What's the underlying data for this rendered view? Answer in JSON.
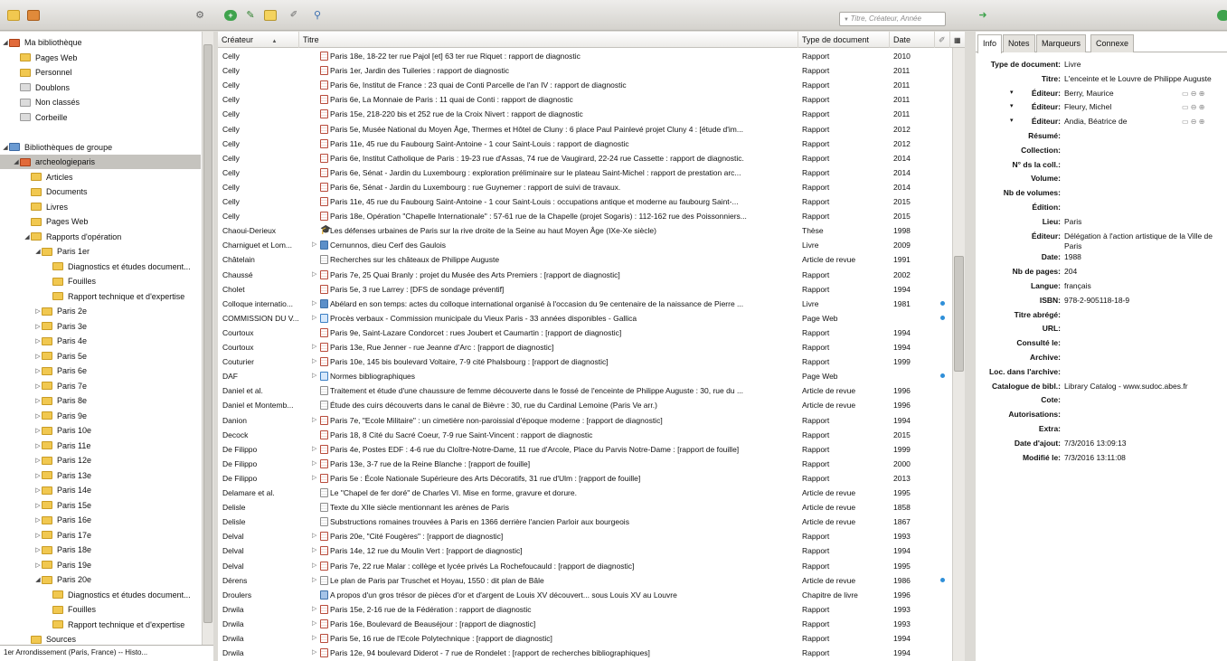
{
  "toolbar": {
    "search_placeholder": "Titre, Créateur, Année"
  },
  "left_tree": [
    {
      "label": "Ma bibliothèque",
      "indent": 0,
      "twisty": "◢",
      "folder": "red"
    },
    {
      "label": "Pages Web",
      "indent": 1,
      "twisty": "",
      "folder": "yel"
    },
    {
      "label": "Personnel",
      "indent": 1,
      "twisty": "",
      "folder": "yel"
    },
    {
      "label": "Doublons",
      "indent": 1,
      "twisty": "",
      "folder": "grey"
    },
    {
      "label": "Non classés",
      "indent": 1,
      "twisty": "",
      "folder": "grey"
    },
    {
      "label": "Corbeille",
      "indent": 1,
      "twisty": "",
      "folder": "grey"
    },
    {
      "label": "",
      "indent": 0,
      "twisty": "",
      "folder": ""
    },
    {
      "label": "Bibliothèques de groupe",
      "indent": 0,
      "twisty": "◢",
      "folder": "grp"
    },
    {
      "label": "archeologieparis",
      "indent": 1,
      "twisty": "◢",
      "folder": "red",
      "selected": true
    },
    {
      "label": "Articles",
      "indent": 2,
      "twisty": "",
      "folder": "yel"
    },
    {
      "label": "Documents",
      "indent": 2,
      "twisty": "",
      "folder": "yel"
    },
    {
      "label": "Livres",
      "indent": 2,
      "twisty": "",
      "folder": "yel"
    },
    {
      "label": "Pages Web",
      "indent": 2,
      "twisty": "",
      "folder": "yel"
    },
    {
      "label": "Rapports d'opération",
      "indent": 2,
      "twisty": "◢",
      "folder": "yel"
    },
    {
      "label": "Paris 1er",
      "indent": 3,
      "twisty": "◢",
      "folder": "yel"
    },
    {
      "label": "Diagnostics et études document...",
      "indent": 4,
      "twisty": "",
      "folder": "yel"
    },
    {
      "label": "Fouilles",
      "indent": 4,
      "twisty": "",
      "folder": "yel"
    },
    {
      "label": "Rapport technique et d'expertise",
      "indent": 4,
      "twisty": "",
      "folder": "yel"
    },
    {
      "label": "Paris 2e",
      "indent": 3,
      "twisty": "▷",
      "folder": "yel"
    },
    {
      "label": "Paris 3e",
      "indent": 3,
      "twisty": "▷",
      "folder": "yel"
    },
    {
      "label": "Paris 4e",
      "indent": 3,
      "twisty": "▷",
      "folder": "yel"
    },
    {
      "label": "Paris 5e",
      "indent": 3,
      "twisty": "▷",
      "folder": "yel"
    },
    {
      "label": "Paris 6e",
      "indent": 3,
      "twisty": "▷",
      "folder": "yel"
    },
    {
      "label": "Paris 7e",
      "indent": 3,
      "twisty": "▷",
      "folder": "yel"
    },
    {
      "label": "Paris 8e",
      "indent": 3,
      "twisty": "▷",
      "folder": "yel"
    },
    {
      "label": "Paris 9e",
      "indent": 3,
      "twisty": "▷",
      "folder": "yel"
    },
    {
      "label": "Paris 10e",
      "indent": 3,
      "twisty": "▷",
      "folder": "yel"
    },
    {
      "label": "Paris 11e",
      "indent": 3,
      "twisty": "▷",
      "folder": "yel"
    },
    {
      "label": "Paris 12e",
      "indent": 3,
      "twisty": "▷",
      "folder": "yel"
    },
    {
      "label": "Paris 13e",
      "indent": 3,
      "twisty": "▷",
      "folder": "yel"
    },
    {
      "label": "Paris 14e",
      "indent": 3,
      "twisty": "▷",
      "folder": "yel"
    },
    {
      "label": "Paris 15e",
      "indent": 3,
      "twisty": "▷",
      "folder": "yel"
    },
    {
      "label": "Paris 16e",
      "indent": 3,
      "twisty": "▷",
      "folder": "yel"
    },
    {
      "label": "Paris 17e",
      "indent": 3,
      "twisty": "▷",
      "folder": "yel"
    },
    {
      "label": "Paris 18e",
      "indent": 3,
      "twisty": "▷",
      "folder": "yel"
    },
    {
      "label": "Paris 19e",
      "indent": 3,
      "twisty": "▷",
      "folder": "yel"
    },
    {
      "label": "Paris 20e",
      "indent": 3,
      "twisty": "◢",
      "folder": "yel"
    },
    {
      "label": "Diagnostics et études document...",
      "indent": 4,
      "twisty": "",
      "folder": "yel"
    },
    {
      "label": "Fouilles",
      "indent": 4,
      "twisty": "",
      "folder": "yel"
    },
    {
      "label": "Rapport technique et d'expertise",
      "indent": 4,
      "twisty": "",
      "folder": "yel"
    },
    {
      "label": "Sources",
      "indent": 2,
      "twisty": "",
      "folder": "yel"
    }
  ],
  "left_status": "1er Arrondissement (Paris, France) -- Histo...",
  "columns": {
    "creator": "Créateur",
    "title": "Titre",
    "type": "Type de document",
    "date": "Date"
  },
  "items": [
    {
      "creator": "Celly",
      "title": "Paris 18e, 18-22 ter rue Pajol [et] 63 ter rue Riquet : rapport de diagnostic",
      "type": "Rapport",
      "date": "2010",
      "icon": "rapport",
      "twisty": "",
      "attach": false
    },
    {
      "creator": "Celly",
      "title": "Paris 1er, Jardin des Tuileries : rapport de diagnostic",
      "type": "Rapport",
      "date": "2011",
      "icon": "rapport",
      "twisty": "",
      "attach": false
    },
    {
      "creator": "Celly",
      "title": "Paris 6e, Institut de France : 23 quai de Conti Parcelle de l'an IV : rapport de diagnostic",
      "type": "Rapport",
      "date": "2011",
      "icon": "rapport",
      "twisty": "",
      "attach": false
    },
    {
      "creator": "Celly",
      "title": "Paris 6e, La Monnaie de Paris : 11 quai de Conti : rapport de diagnostic",
      "type": "Rapport",
      "date": "2011",
      "icon": "rapport",
      "twisty": "",
      "attach": false
    },
    {
      "creator": "Celly",
      "title": "Paris 15e, 218-220 bis et 252 rue de la Croix Nivert : rapport de diagnostic",
      "type": "Rapport",
      "date": "2011",
      "icon": "rapport",
      "twisty": "",
      "attach": false
    },
    {
      "creator": "Celly",
      "title": "Paris 5e, Musée National du Moyen Âge, Thermes et Hôtel de Cluny : 6 place Paul Painlevé projet Cluny 4 : [étude d'im...",
      "type": "Rapport",
      "date": "2012",
      "icon": "rapport",
      "twisty": "",
      "attach": false
    },
    {
      "creator": "Celly",
      "title": "Paris 11e, 45 rue du Faubourg Saint-Antoine - 1 cour Saint-Louis : rapport de diagnostic",
      "type": "Rapport",
      "date": "2012",
      "icon": "rapport",
      "twisty": "",
      "attach": false
    },
    {
      "creator": "Celly",
      "title": "Paris 6e, Institut Catholique de Paris : 19-23 rue d'Assas, 74 rue de Vaugirard, 22-24 rue Cassette : rapport de diagnostic.",
      "type": "Rapport",
      "date": "2014",
      "icon": "rapport",
      "twisty": "",
      "attach": false
    },
    {
      "creator": "Celly",
      "title": "Paris 6e, Sénat - Jardin du Luxembourg : exploration préliminaire sur le plateau Saint-Michel : rapport de prestation arc...",
      "type": "Rapport",
      "date": "2014",
      "icon": "rapport",
      "twisty": "",
      "attach": false
    },
    {
      "creator": "Celly",
      "title": "Paris 6e, Sénat - Jardin du Luxembourg : rue Guynemer : rapport de suivi de travaux.",
      "type": "Rapport",
      "date": "2014",
      "icon": "rapport",
      "twisty": "",
      "attach": false
    },
    {
      "creator": "Celly",
      "title": "Paris 11e, 45 rue du Faubourg Saint-Antoine - 1 cour Saint-Louis : occupations antique et moderne au faubourg Saint-...",
      "type": "Rapport",
      "date": "2015",
      "icon": "rapport",
      "twisty": "",
      "attach": false
    },
    {
      "creator": "Celly",
      "title": "Paris 18e, Opération \"Chapelle Internationale\" : 57-61 rue de la Chapelle (projet Sogaris) : 112-162 rue des Poissonniers...",
      "type": "Rapport",
      "date": "2015",
      "icon": "rapport",
      "twisty": "",
      "attach": false
    },
    {
      "creator": "Chaoui-Derieux",
      "title": "Les défenses urbaines de Paris sur la rive droite de la Seine au haut Moyen Âge (IXe-Xe siècle)",
      "type": "Thèse",
      "date": "1998",
      "icon": "thesis",
      "twisty": "",
      "attach": false
    },
    {
      "creator": "Charniguet et Lom...",
      "title": "Cernunnos, dieu Cerf des Gaulois",
      "type": "Livre",
      "date": "2009",
      "icon": "book",
      "twisty": "▷",
      "attach": false
    },
    {
      "creator": "Châtelain",
      "title": "Recherches sur les châteaux de Philippe Auguste",
      "type": "Article de revue",
      "date": "1991",
      "icon": "article",
      "twisty": "",
      "attach": false
    },
    {
      "creator": "Chaussé",
      "title": "Paris 7e, 25 Quai Branly : projet du Musée des Arts Premiers : [rapport de diagnostic]",
      "type": "Rapport",
      "date": "2002",
      "icon": "rapport",
      "twisty": "▷",
      "attach": false
    },
    {
      "creator": "Cholet",
      "title": "Paris 5e, 3 rue Larrey : [DFS de sondage préventif]",
      "type": "Rapport",
      "date": "1994",
      "icon": "rapport",
      "twisty": "",
      "attach": false
    },
    {
      "creator": "Colloque internatio...",
      "title": "Abélard en son temps: actes du colloque international organisé à l'occasion du 9e centenaire de la naissance de Pierre ...",
      "type": "Livre",
      "date": "1981",
      "icon": "book",
      "twisty": "▷",
      "attach": true
    },
    {
      "creator": "COMMISSION DU V...",
      "title": "Procès verbaux - Commission municipale du Vieux Paris - 33 années disponibles - Gallica",
      "type": "Page Web",
      "date": "",
      "icon": "web",
      "twisty": "▷",
      "attach": true
    },
    {
      "creator": "Courtoux",
      "title": "Paris 9e, Saint-Lazare Condorcet : rues Joubert et Caumartin : [rapport de diagnostic]",
      "type": "Rapport",
      "date": "1994",
      "icon": "rapport",
      "twisty": "",
      "attach": false
    },
    {
      "creator": "Courtoux",
      "title": "Paris 13e, Rue Jenner - rue Jeanne d'Arc : [rapport de diagnostic]",
      "type": "Rapport",
      "date": "1994",
      "icon": "rapport",
      "twisty": "▷",
      "attach": false
    },
    {
      "creator": "Couturier",
      "title": "Paris 10e, 145 bis boulevard Voltaire, 7-9 cité Phalsbourg : [rapport de diagnostic]",
      "type": "Rapport",
      "date": "1999",
      "icon": "rapport",
      "twisty": "▷",
      "attach": false
    },
    {
      "creator": "DAF",
      "title": "Normes bibliographiques",
      "type": "Page Web",
      "date": "",
      "icon": "web",
      "twisty": "▷",
      "attach": true
    },
    {
      "creator": "Daniel et al.",
      "title": "Traitement et étude d'une chaussure de femme découverte dans le fossé de l'enceinte de Philippe Auguste : 30, rue du ...",
      "type": "Article de revue",
      "date": "1996",
      "icon": "article",
      "twisty": "",
      "attach": false
    },
    {
      "creator": "Daniel et Montemb...",
      "title": "Étude des cuirs découverts dans le canal de Bièvre : 30, rue du Cardinal Lemoine (Paris Ve arr.)",
      "type": "Article de revue",
      "date": "1996",
      "icon": "article",
      "twisty": "",
      "attach": false
    },
    {
      "creator": "Danion",
      "title": "Paris 7e, \"Ecole Militaire\" : un cimetière non-paroissial d'époque moderne : [rapport de diagnostic]",
      "type": "Rapport",
      "date": "1994",
      "icon": "rapport",
      "twisty": "▷",
      "attach": false
    },
    {
      "creator": "Decock",
      "title": "Paris 18, 8 Cité du Sacré Coeur, 7-9 rue Saint-Vincent : rapport de diagnostic",
      "type": "Rapport",
      "date": "2015",
      "icon": "rapport",
      "twisty": "",
      "attach": false
    },
    {
      "creator": "De Filippo",
      "title": "Paris 4e, Postes EDF : 4-6 rue du Cloître-Notre-Dame, 11 rue d'Arcole, Place du Parvis Notre-Dame : [rapport de fouille]",
      "type": "Rapport",
      "date": "1999",
      "icon": "rapport",
      "twisty": "▷",
      "attach": false
    },
    {
      "creator": "De Filippo",
      "title": "Paris 13e, 3-7 rue de la Reine Blanche : [rapport de fouille]",
      "type": "Rapport",
      "date": "2000",
      "icon": "rapport",
      "twisty": "▷",
      "attach": false
    },
    {
      "creator": "De Filippo",
      "title": "Paris 5e : École Nationale Supérieure des Arts Décoratifs, 31 rue d'Ulm : [rapport de fouille]",
      "type": "Rapport",
      "date": "2013",
      "icon": "rapport",
      "twisty": "▷",
      "attach": false
    },
    {
      "creator": "Delamare et al.",
      "title": "Le \"Chapel de fer doré\" de Charles VI. Mise en forme, gravure et dorure.",
      "type": "Article de revue",
      "date": "1995",
      "icon": "article",
      "twisty": "",
      "attach": false
    },
    {
      "creator": "Delisle",
      "title": "Texte du XIIe siècle mentionnant les arènes de Paris",
      "type": "Article de revue",
      "date": "1858",
      "icon": "article",
      "twisty": "",
      "attach": false
    },
    {
      "creator": "Delisle",
      "title": "Substructions romaines trouvées à Paris en 1366 derrière l'ancien Parloir aux bourgeois",
      "type": "Article de revue",
      "date": "1867",
      "icon": "article",
      "twisty": "",
      "attach": false
    },
    {
      "creator": "Delval",
      "title": "Paris 20e, \"Cité Fougères\" : [rapport de diagnostic]",
      "type": "Rapport",
      "date": "1993",
      "icon": "rapport",
      "twisty": "▷",
      "attach": false
    },
    {
      "creator": "Delval",
      "title": "Paris 14e, 12 rue du Moulin Vert : [rapport de diagnostic]",
      "type": "Rapport",
      "date": "1994",
      "icon": "rapport",
      "twisty": "▷",
      "attach": false
    },
    {
      "creator": "Delval",
      "title": "Paris 7e, 22 rue Malar : collège et lycée privés La Rochefoucauld : [rapport de diagnostic]",
      "type": "Rapport",
      "date": "1995",
      "icon": "rapport",
      "twisty": "▷",
      "attach": false
    },
    {
      "creator": "Dérens",
      "title": "Le plan de Paris par Truschet et Hoyau, 1550 : dit plan de Bâle",
      "type": "Article de revue",
      "date": "1986",
      "icon": "article",
      "twisty": "▷",
      "attach": true
    },
    {
      "creator": "Droulers",
      "title": "A propos d'un gros trésor de pièces d'or et d'argent de Louis XV découvert... sous Louis XV au Louvre",
      "type": "Chapitre de livre",
      "date": "1996",
      "icon": "chapter",
      "twisty": "",
      "attach": false
    },
    {
      "creator": "Drwila",
      "title": "Paris 15e, 2-16 rue de la Fédération : rapport de diagnostic",
      "type": "Rapport",
      "date": "1993",
      "icon": "rapport",
      "twisty": "▷",
      "attach": false
    },
    {
      "creator": "Drwila",
      "title": "Paris 16e, Boulevard de Beauséjour : [rapport de diagnostic]",
      "type": "Rapport",
      "date": "1993",
      "icon": "rapport",
      "twisty": "▷",
      "attach": false
    },
    {
      "creator": "Drwila",
      "title": "Paris 5e, 16 rue de l'Ecole Polytechnique : [rapport de diagnostic]",
      "type": "Rapport",
      "date": "1994",
      "icon": "rapport",
      "twisty": "▷",
      "attach": false
    },
    {
      "creator": "Drwila",
      "title": "Paris 12e, 94 boulevard Diderot - 7 rue de Rondelet : [rapport de recherches bibliographiques]",
      "type": "Rapport",
      "date": "1994",
      "icon": "rapport",
      "twisty": "▷",
      "attach": false
    }
  ],
  "tabs": [
    {
      "label": "Info",
      "active": true
    },
    {
      "label": "Notes",
      "active": false
    },
    {
      "label": "Marqueurs",
      "active": false
    },
    {
      "label": "Connexe",
      "active": false
    }
  ],
  "info": [
    {
      "label": "Type de document:",
      "value": "Livre"
    },
    {
      "label": "Titre:",
      "value": "L'enceinte et le Louvre de Philippe Auguste"
    },
    {
      "label": "Éditeur:",
      "value": "Berry, Maurice",
      "creator": true
    },
    {
      "label": "Éditeur:",
      "value": "Fleury, Michel",
      "creator": true
    },
    {
      "label": "Éditeur:",
      "value": "Andia, Béatrice de",
      "creator": true
    },
    {
      "label": "Résumé:",
      "value": ""
    },
    {
      "label": "Collection:",
      "value": ""
    },
    {
      "label": "N° ds la coll.:",
      "value": ""
    },
    {
      "label": "Volume:",
      "value": ""
    },
    {
      "label": "Nb de volumes:",
      "value": ""
    },
    {
      "label": "Édition:",
      "value": ""
    },
    {
      "label": "Lieu:",
      "value": "Paris"
    },
    {
      "label": "Éditeur:",
      "value": "Délégation à l'action artistique de la Ville de",
      "value2": "Paris"
    },
    {
      "label": "Date:",
      "value": "1988"
    },
    {
      "label": "Nb de pages:",
      "value": "204"
    },
    {
      "label": "Langue:",
      "value": "français"
    },
    {
      "label": "ISBN:",
      "value": "978-2-905118-18-9"
    },
    {
      "label": "Titre abrégé:",
      "value": ""
    },
    {
      "label": "URL:",
      "value": ""
    },
    {
      "label": "Consulté le:",
      "value": ""
    },
    {
      "label": "Archive:",
      "value": ""
    },
    {
      "label": "Loc. dans l'archive:",
      "value": ""
    },
    {
      "label": "Catalogue de bibl.:",
      "value": "Library Catalog - www.sudoc.abes.fr"
    },
    {
      "label": "Cote:",
      "value": ""
    },
    {
      "label": "Autorisations:",
      "value": ""
    },
    {
      "label": "Extra:",
      "value": ""
    },
    {
      "label": "Date d'ajout:",
      "value": "7/3/2016 13:09:13"
    },
    {
      "label": "Modifié le:",
      "value": "7/3/2016 13:11:08"
    }
  ]
}
